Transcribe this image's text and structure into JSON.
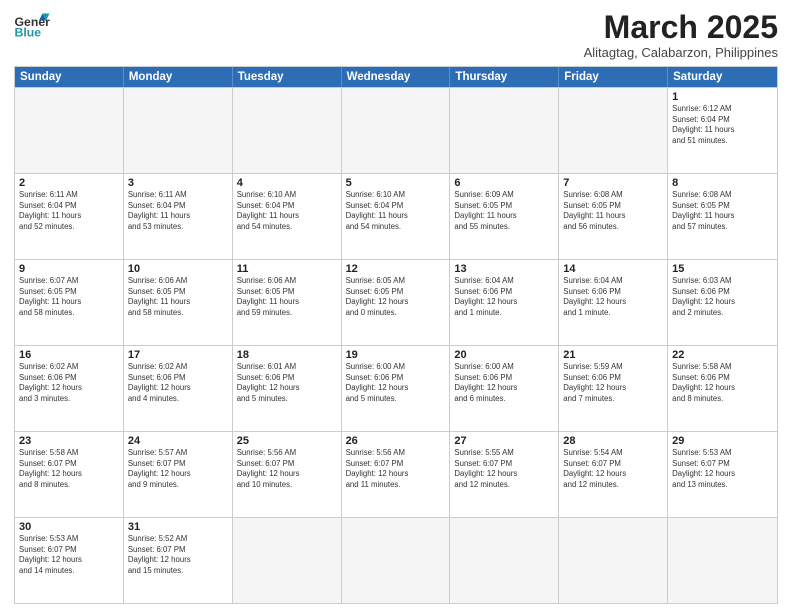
{
  "header": {
    "logo_general": "General",
    "logo_blue": "Blue",
    "month_title": "March 2025",
    "location": "Alitagtag, Calabarzon, Philippines"
  },
  "days_of_week": [
    "Sunday",
    "Monday",
    "Tuesday",
    "Wednesday",
    "Thursday",
    "Friday",
    "Saturday"
  ],
  "weeks": [
    [
      {
        "num": "",
        "info": "",
        "empty": true
      },
      {
        "num": "",
        "info": "",
        "empty": true
      },
      {
        "num": "",
        "info": "",
        "empty": true
      },
      {
        "num": "",
        "info": "",
        "empty": true
      },
      {
        "num": "",
        "info": "",
        "empty": true
      },
      {
        "num": "",
        "info": "",
        "empty": true
      },
      {
        "num": "1",
        "info": "Sunrise: 6:12 AM\nSunset: 6:04 PM\nDaylight: 11 hours\nand 51 minutes.",
        "empty": false
      }
    ],
    [
      {
        "num": "2",
        "info": "Sunrise: 6:11 AM\nSunset: 6:04 PM\nDaylight: 11 hours\nand 52 minutes.",
        "empty": false
      },
      {
        "num": "3",
        "info": "Sunrise: 6:11 AM\nSunset: 6:04 PM\nDaylight: 11 hours\nand 53 minutes.",
        "empty": false
      },
      {
        "num": "4",
        "info": "Sunrise: 6:10 AM\nSunset: 6:04 PM\nDaylight: 11 hours\nand 54 minutes.",
        "empty": false
      },
      {
        "num": "5",
        "info": "Sunrise: 6:10 AM\nSunset: 6:04 PM\nDaylight: 11 hours\nand 54 minutes.",
        "empty": false
      },
      {
        "num": "6",
        "info": "Sunrise: 6:09 AM\nSunset: 6:05 PM\nDaylight: 11 hours\nand 55 minutes.",
        "empty": false
      },
      {
        "num": "7",
        "info": "Sunrise: 6:08 AM\nSunset: 6:05 PM\nDaylight: 11 hours\nand 56 minutes.",
        "empty": false
      },
      {
        "num": "8",
        "info": "Sunrise: 6:08 AM\nSunset: 6:05 PM\nDaylight: 11 hours\nand 57 minutes.",
        "empty": false
      }
    ],
    [
      {
        "num": "9",
        "info": "Sunrise: 6:07 AM\nSunset: 6:05 PM\nDaylight: 11 hours\nand 58 minutes.",
        "empty": false
      },
      {
        "num": "10",
        "info": "Sunrise: 6:06 AM\nSunset: 6:05 PM\nDaylight: 11 hours\nand 58 minutes.",
        "empty": false
      },
      {
        "num": "11",
        "info": "Sunrise: 6:06 AM\nSunset: 6:05 PM\nDaylight: 11 hours\nand 59 minutes.",
        "empty": false
      },
      {
        "num": "12",
        "info": "Sunrise: 6:05 AM\nSunset: 6:05 PM\nDaylight: 12 hours\nand 0 minutes.",
        "empty": false
      },
      {
        "num": "13",
        "info": "Sunrise: 6:04 AM\nSunset: 6:06 PM\nDaylight: 12 hours\nand 1 minute.",
        "empty": false
      },
      {
        "num": "14",
        "info": "Sunrise: 6:04 AM\nSunset: 6:06 PM\nDaylight: 12 hours\nand 1 minute.",
        "empty": false
      },
      {
        "num": "15",
        "info": "Sunrise: 6:03 AM\nSunset: 6:06 PM\nDaylight: 12 hours\nand 2 minutes.",
        "empty": false
      }
    ],
    [
      {
        "num": "16",
        "info": "Sunrise: 6:02 AM\nSunset: 6:06 PM\nDaylight: 12 hours\nand 3 minutes.",
        "empty": false
      },
      {
        "num": "17",
        "info": "Sunrise: 6:02 AM\nSunset: 6:06 PM\nDaylight: 12 hours\nand 4 minutes.",
        "empty": false
      },
      {
        "num": "18",
        "info": "Sunrise: 6:01 AM\nSunset: 6:06 PM\nDaylight: 12 hours\nand 5 minutes.",
        "empty": false
      },
      {
        "num": "19",
        "info": "Sunrise: 6:00 AM\nSunset: 6:06 PM\nDaylight: 12 hours\nand 5 minutes.",
        "empty": false
      },
      {
        "num": "20",
        "info": "Sunrise: 6:00 AM\nSunset: 6:06 PM\nDaylight: 12 hours\nand 6 minutes.",
        "empty": false
      },
      {
        "num": "21",
        "info": "Sunrise: 5:59 AM\nSunset: 6:06 PM\nDaylight: 12 hours\nand 7 minutes.",
        "empty": false
      },
      {
        "num": "22",
        "info": "Sunrise: 5:58 AM\nSunset: 6:06 PM\nDaylight: 12 hours\nand 8 minutes.",
        "empty": false
      }
    ],
    [
      {
        "num": "23",
        "info": "Sunrise: 5:58 AM\nSunset: 6:07 PM\nDaylight: 12 hours\nand 8 minutes.",
        "empty": false
      },
      {
        "num": "24",
        "info": "Sunrise: 5:57 AM\nSunset: 6:07 PM\nDaylight: 12 hours\nand 9 minutes.",
        "empty": false
      },
      {
        "num": "25",
        "info": "Sunrise: 5:56 AM\nSunset: 6:07 PM\nDaylight: 12 hours\nand 10 minutes.",
        "empty": false
      },
      {
        "num": "26",
        "info": "Sunrise: 5:56 AM\nSunset: 6:07 PM\nDaylight: 12 hours\nand 11 minutes.",
        "empty": false
      },
      {
        "num": "27",
        "info": "Sunrise: 5:55 AM\nSunset: 6:07 PM\nDaylight: 12 hours\nand 12 minutes.",
        "empty": false
      },
      {
        "num": "28",
        "info": "Sunrise: 5:54 AM\nSunset: 6:07 PM\nDaylight: 12 hours\nand 12 minutes.",
        "empty": false
      },
      {
        "num": "29",
        "info": "Sunrise: 5:53 AM\nSunset: 6:07 PM\nDaylight: 12 hours\nand 13 minutes.",
        "empty": false
      }
    ],
    [
      {
        "num": "30",
        "info": "Sunrise: 5:53 AM\nSunset: 6:07 PM\nDaylight: 12 hours\nand 14 minutes.",
        "empty": false
      },
      {
        "num": "31",
        "info": "Sunrise: 5:52 AM\nSunset: 6:07 PM\nDaylight: 12 hours\nand 15 minutes.",
        "empty": false
      },
      {
        "num": "",
        "info": "",
        "empty": true
      },
      {
        "num": "",
        "info": "",
        "empty": true
      },
      {
        "num": "",
        "info": "",
        "empty": true
      },
      {
        "num": "",
        "info": "",
        "empty": true
      },
      {
        "num": "",
        "info": "",
        "empty": true
      }
    ]
  ]
}
